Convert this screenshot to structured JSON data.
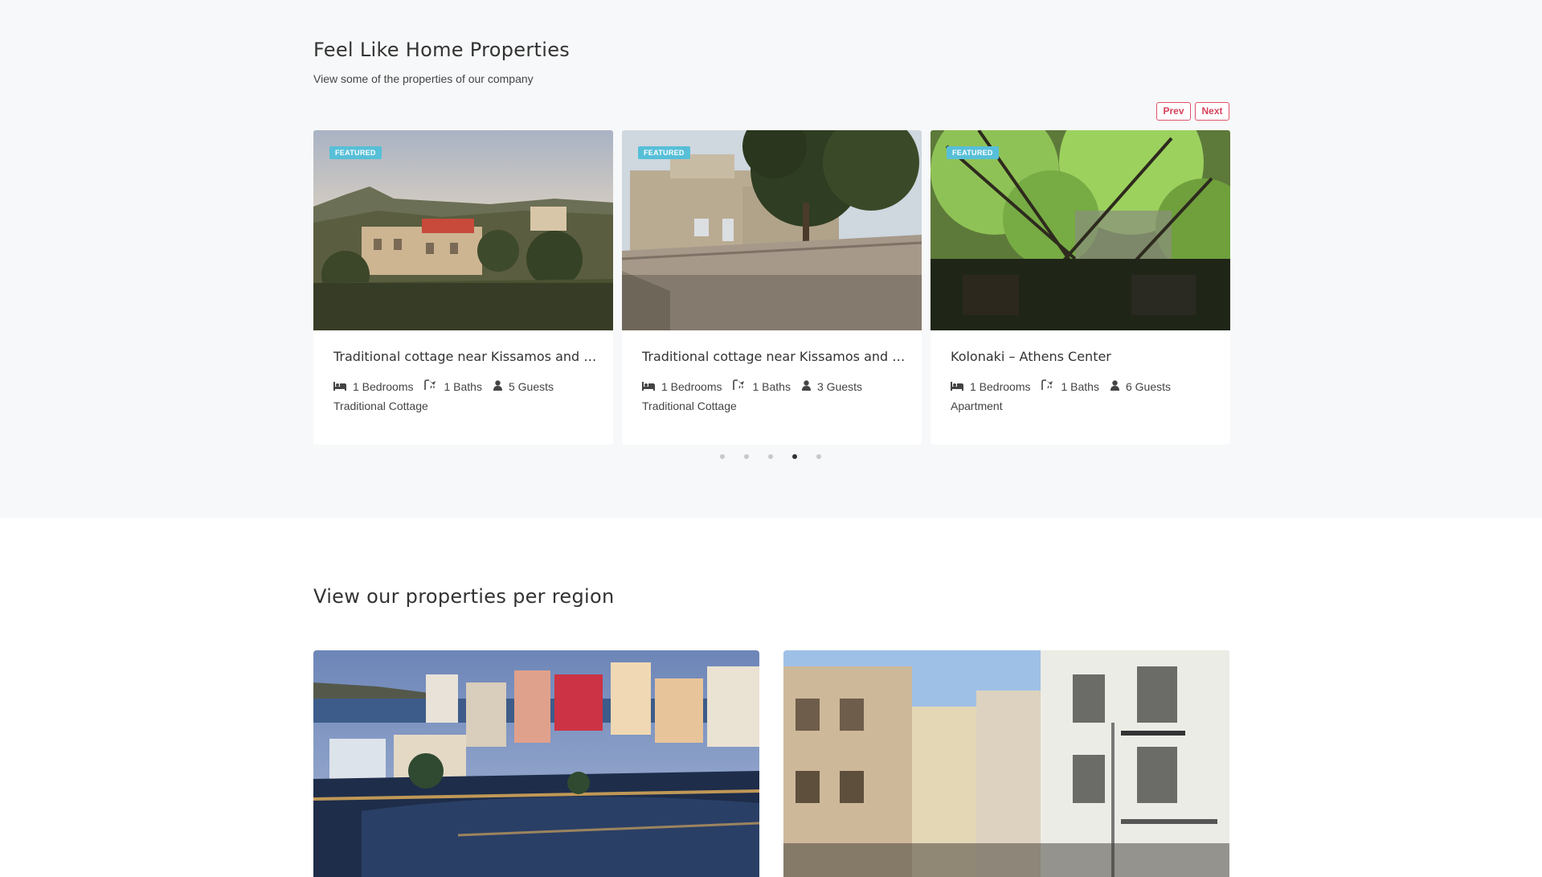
{
  "featured": {
    "title": "Feel Like Home Properties",
    "subtitle": "View some of the properties of our company",
    "prev_label": "Prev",
    "next_label": "Next",
    "cards": [
      {
        "badge": "FEATURED",
        "title": "Traditional cottage near Kissamos and Falasarna",
        "title_display": "Traditional cottage near Kissamos and …",
        "bedrooms": "1 Bedrooms",
        "baths": "1 Baths",
        "guests": "5 Guests",
        "type": "Traditional Cottage"
      },
      {
        "badge": "FEATURED",
        "title": "Traditional cottage near Kissamos and …",
        "title_display": "Traditional cottage near Kissamos and …",
        "bedrooms": "1 Bedrooms",
        "baths": "1 Baths",
        "guests": "3 Guests",
        "type": "Traditional Cottage"
      },
      {
        "badge": "FEATURED",
        "title": "Kolonaki – Athens Center",
        "title_display": "Kolonaki – Athens Center",
        "bedrooms": "1 Bedrooms",
        "baths": "1 Baths",
        "guests": "6 Guests",
        "type": "Apartment"
      }
    ],
    "pagination": {
      "total": 5,
      "active_index": 3
    }
  },
  "regions": {
    "title": "View our properties per region"
  },
  "icons": {
    "bedrooms": "bed-icon",
    "baths": "shower-icon",
    "guests": "user-icon"
  },
  "colors": {
    "accent": "#d6425b",
    "badge": "#57bfd8",
    "section_bg": "#f7f8f9"
  }
}
